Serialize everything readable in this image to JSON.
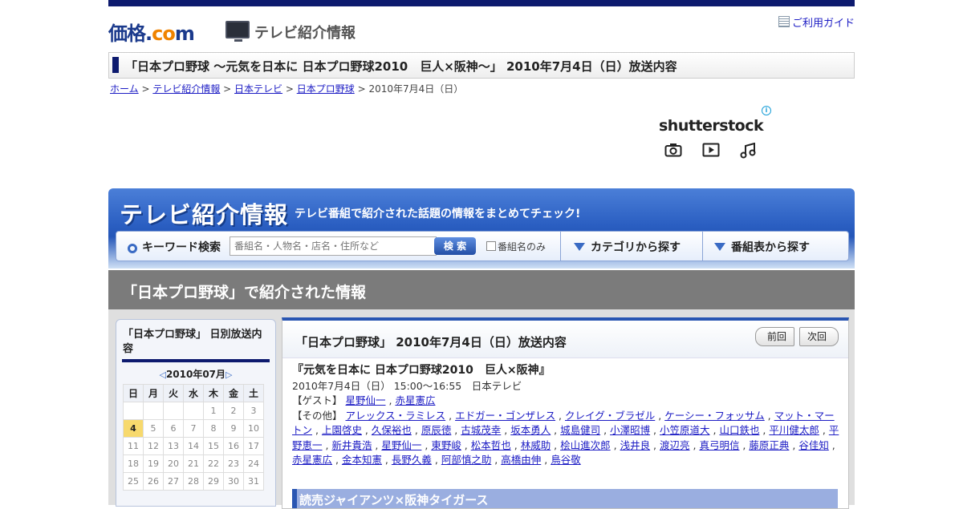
{
  "header": {
    "logo_main": "価格",
    "logo_dot": ".",
    "logo_co": "co",
    "logo_m": "m",
    "section_title": "テレビ紹介情報",
    "guide_link": "ご利用ガイド"
  },
  "page_title": "「日本プロ野球 ～元気を日本に 日本プロ野球2010　巨人×阪神～」 2010年7月4日（日）放送内容",
  "breadcrumb": {
    "home": "ホーム",
    "tv_info": "テレビ紹介情報",
    "channel": "日本テレビ",
    "program": "日本プロ野球",
    "current": "2010年7月4日（日）",
    "sep": " > "
  },
  "ad": {
    "brand": "shutterstock",
    "info": "i",
    "icons": [
      "camera-icon",
      "video-play-icon",
      "music-note-icon"
    ]
  },
  "banner": {
    "title": "テレビ紹介情報",
    "subtitle": "テレビ番組で紹介された話題の情報をまとめてチェック!",
    "keyword_label": "キーワード検索",
    "search_placeholder": "番組名・人物名・店名・住所など",
    "search_button": "検 索",
    "checkbox_label": "番組名のみ",
    "category_nav": "カテゴリから探す",
    "schedule_nav": "番組表から探す"
  },
  "gray_title": "「日本プロ野球」で紹介された情報",
  "calendar": {
    "title": "「日本プロ野球」 日別放送内容",
    "month": "2010年07月",
    "weekdays": [
      "日",
      "月",
      "火",
      "水",
      "木",
      "金",
      "土"
    ],
    "weeks": [
      [
        "",
        "",
        "",
        "",
        "1",
        "2",
        "3"
      ],
      [
        "4",
        "5",
        "6",
        "7",
        "8",
        "9",
        "10"
      ],
      [
        "11",
        "12",
        "13",
        "14",
        "15",
        "16",
        "17"
      ],
      [
        "18",
        "19",
        "20",
        "21",
        "22",
        "23",
        "24"
      ],
      [
        "25",
        "26",
        "27",
        "28",
        "29",
        "30",
        "31"
      ]
    ],
    "active_day": "4"
  },
  "main": {
    "heading": "「日本プロ野球」 2010年7月4日（日）放送内容",
    "prev": "前回",
    "next": "次回",
    "program_title": "『元気を日本に 日本プロ野球2010　巨人×阪神』",
    "broadcast": "2010年7月4日（日）  15:00～16:55　日本テレビ",
    "guest_label": "【ゲスト】",
    "guests": [
      "星野仙一",
      "赤星憲広"
    ],
    "others_label": "【その他】",
    "others": [
      "アレックス・ラミレス",
      "エドガー・ゴンザレス",
      "クレイグ・ブラゼル",
      "ケーシー・フォッサム",
      "マット・マートン",
      "上園啓史",
      "久保裕也",
      "原辰徳",
      "古城茂幸",
      "坂本勇人",
      "城島健司",
      "小澤昭博",
      "小笠原道大",
      "山口鉄也",
      "平川健太郎",
      "平野恵一",
      "新井貴浩",
      "星野仙一",
      "東野峻",
      "松本哲也",
      "林威助",
      "桧山進次郎",
      "浅井良",
      "渡辺亮",
      "真弓明信",
      "藤原正典",
      "谷佳知",
      "赤星憲広",
      "金本知憲",
      "長野久義",
      "阿部慎之助",
      "高橋由伸",
      "鳥谷敬"
    ],
    "section_heading": "読売ジャイアンツ×阪神タイガース"
  }
}
